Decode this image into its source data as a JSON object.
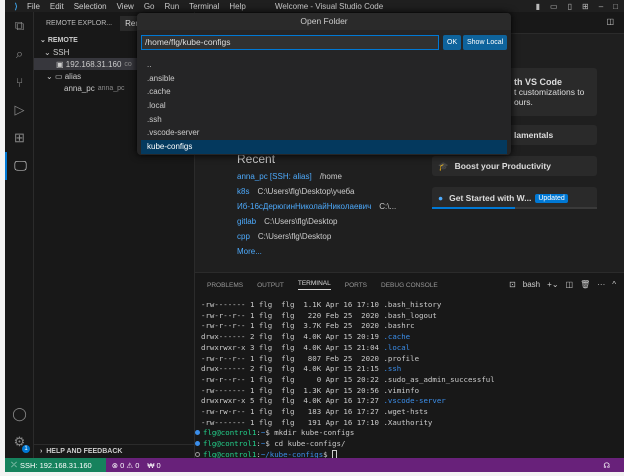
{
  "titlebar": {
    "menu": [
      "File",
      "Edit",
      "Selection",
      "View",
      "Go",
      "Run",
      "Terminal",
      "Help"
    ],
    "title": "Welcome - Visual Studio Code"
  },
  "sidebar": {
    "header": "REMOTE EXPLOR...",
    "tab": "Remot",
    "section": "REMOTE",
    "ssh": "SSH",
    "host": "192.168.31.160",
    "host_extra": "co",
    "alias": "alias",
    "alias_child": "anna_pc",
    "alias_child_dim": "anna_pc",
    "help": "HELP AND FEEDBACK"
  },
  "quickpick": {
    "title": "Open Folder",
    "input": "/home/flg/kube-configs",
    "ok": "OK",
    "show_local": "Show Local",
    "items": [
      "..",
      ".ansible",
      ".cache",
      ".local",
      ".ssh",
      ".vscode-server",
      "kube-configs"
    ],
    "selected": 6
  },
  "welcome": {
    "recent_title": "Recent",
    "recent": [
      {
        "name": "anna_pc [SSH: alias]",
        "path": "/home"
      },
      {
        "name": "k8s",
        "path": "C:\\Users\\flg\\Desktop\\учеба"
      },
      {
        "name": "Иб-16сДерюгинНиколайНиколаевич",
        "path": "C:\\..."
      },
      {
        "name": "gitlab",
        "path": "C:\\Users\\flg\\Desktop"
      },
      {
        "name": "cpp",
        "path": "C:\\Users\\flg\\Desktop"
      }
    ],
    "more": "More...",
    "card1_title": "th VS Code",
    "card1_l1": "t customizations to",
    "card1_l2": "ours.",
    "card2": "lamentals",
    "card3": "Boost your Productivity",
    "card4": "Get Started with W...",
    "card4_badge": "Updated",
    "card4_progress": 0.5
  },
  "panel": {
    "tabs": [
      "PROBLEMS",
      "OUTPUT",
      "TERMINAL",
      "PORTS",
      "DEBUG CONSOLE"
    ],
    "active": "TERMINAL",
    "shell": "bash"
  },
  "terminal": {
    "ls": [
      [
        "-rw------- 1 flg  flg  1.1K Apr 16 17:10 ",
        ".bash_history",
        false
      ],
      [
        "-rw-r--r-- 1 flg  flg   220 Feb 25  2020 ",
        ".bash_logout",
        false
      ],
      [
        "-rw-r--r-- 1 flg  flg  3.7K Feb 25  2020 ",
        ".bashrc",
        false
      ],
      [
        "drwx------ 2 flg  flg  4.0K Apr 15 20:19 ",
        ".cache",
        true
      ],
      [
        "drwxrwxr-x 3 flg  flg  4.0K Apr 15 21:04 ",
        ".local",
        true
      ],
      [
        "-rw-r--r-- 1 flg  flg   807 Feb 25  2020 ",
        ".profile",
        false
      ],
      [
        "drwx------ 2 flg  flg  4.0K Apr 15 21:15 ",
        ".ssh",
        true
      ],
      [
        "-rw-r--r-- 1 flg  flg     0 Apr 15 20:22 ",
        ".sudo_as_admin_successful",
        false
      ],
      [
        "-rw------- 1 flg  flg  1.3K Apr 15 20:56 ",
        ".viminfo",
        false
      ],
      [
        "drwxrwxr-x 5 flg  flg  4.0K Apr 16 17:27 ",
        ".vscode-server",
        true
      ],
      [
        "-rw-rw-r-- 1 flg  flg   183 Apr 16 17:27 ",
        ".wget-hsts",
        false
      ],
      [
        "-rw------- 1 flg  flg   191 Apr 16 17:10 ",
        ".Xauthority",
        false
      ]
    ],
    "prompts": [
      {
        "user": "flg@control1",
        "path": "~",
        "cmd": " mkdir kube-configs"
      },
      {
        "user": "flg@control1",
        "path": "~",
        "cmd": " cd kube-configs/"
      },
      {
        "user": "flg@control1",
        "path": "~/kube-configs",
        "cmd": " "
      }
    ]
  },
  "status": {
    "remote": "SSH: 192.168.31.160",
    "errors": "0",
    "warnings": "0",
    "ports": "0"
  },
  "colors": {
    "accent": "#0078d4",
    "status": "#68217a",
    "remote": "#16825d"
  }
}
